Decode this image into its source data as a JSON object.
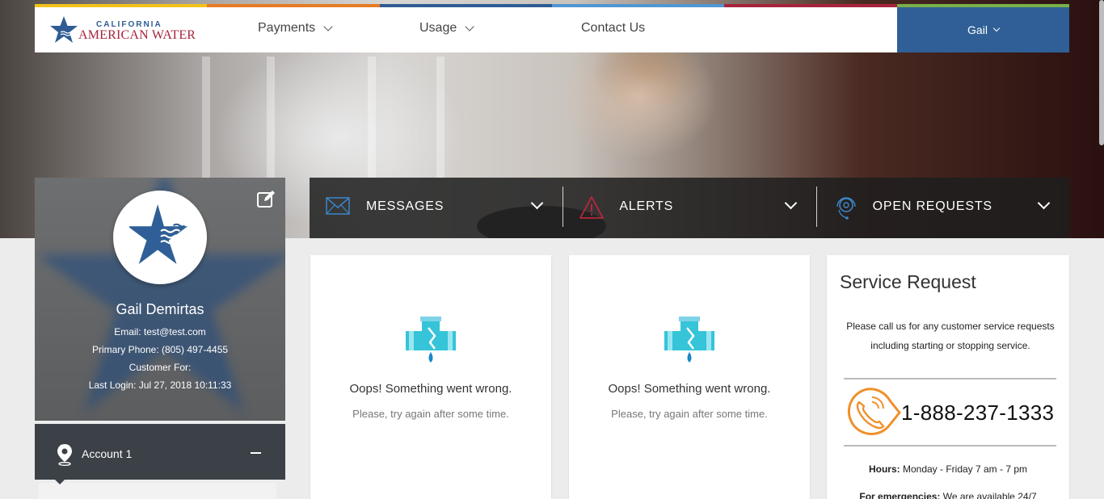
{
  "brand": {
    "line1": "CALIFORNIA",
    "line2": "AMERICAN WATER",
    "colors": {
      "blue": "#2f5c94",
      "red": "#a7233b"
    }
  },
  "color_bar": [
    "#f2c21b",
    "#e57c23",
    "#2f5c94",
    "#4f97d1",
    "#a7233b",
    "#79b14b"
  ],
  "nav": {
    "items": [
      {
        "label": "Payments",
        "has_dropdown": true
      },
      {
        "label": "Usage",
        "has_dropdown": true
      },
      {
        "label": "Contact Us",
        "has_dropdown": false
      }
    ],
    "user": "Gail"
  },
  "profile": {
    "name": "Gail Demirtas",
    "email": "Email: test@test.com",
    "phone": "Primary Phone: (805) 497-4455",
    "customer_for": "Customer For:",
    "last_login": "Last Login: Jul 27, 2018 10:11:33"
  },
  "account": {
    "label": "Account 1"
  },
  "dashboard": [
    {
      "label": "MESSAGES",
      "icon": "envelope-icon"
    },
    {
      "label": "ALERTS",
      "icon": "warning-icon"
    },
    {
      "label": "OPEN REQUESTS",
      "icon": "support-icon"
    }
  ],
  "error_cards": [
    {
      "title": "Oops! Something went wrong.",
      "message": "Please, try again after some time."
    },
    {
      "title": "Oops! Something went wrong.",
      "message": "Please, try again after some time."
    }
  ],
  "service_request": {
    "title": "Service Request",
    "description": "Please call us for any customer service requests including starting or stopping service.",
    "phone": "1-888-237-1333",
    "hours_label": "Hours:",
    "hours": "Monday - Friday 7 am - 7 pm",
    "emergency_label": "For emergencies:",
    "emergency": "We are available 24/7"
  }
}
